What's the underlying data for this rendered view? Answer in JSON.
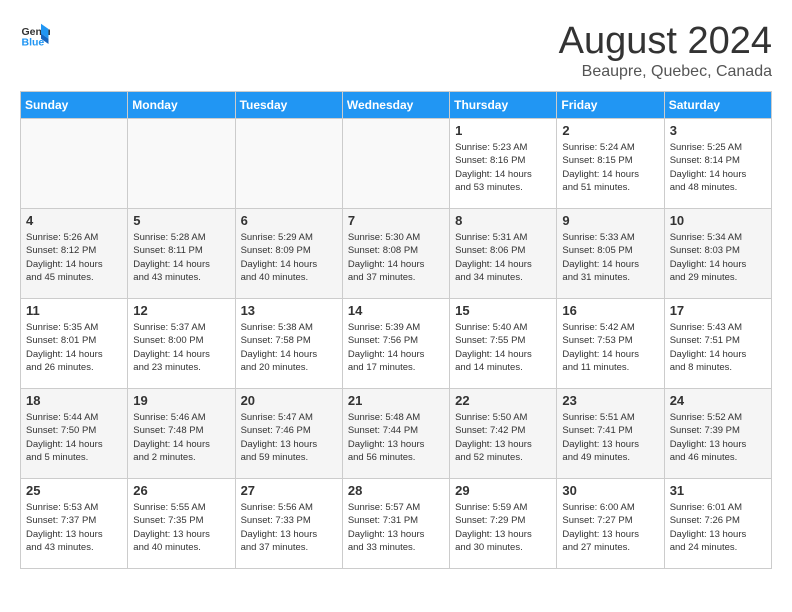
{
  "header": {
    "logo_general": "General",
    "logo_blue": "Blue",
    "month_title": "August 2024",
    "location": "Beaupre, Quebec, Canada"
  },
  "days_of_week": [
    "Sunday",
    "Monday",
    "Tuesday",
    "Wednesday",
    "Thursday",
    "Friday",
    "Saturday"
  ],
  "weeks": [
    [
      {
        "day": "",
        "info": ""
      },
      {
        "day": "",
        "info": ""
      },
      {
        "day": "",
        "info": ""
      },
      {
        "day": "",
        "info": ""
      },
      {
        "day": "1",
        "info": "Sunrise: 5:23 AM\nSunset: 8:16 PM\nDaylight: 14 hours\nand 53 minutes."
      },
      {
        "day": "2",
        "info": "Sunrise: 5:24 AM\nSunset: 8:15 PM\nDaylight: 14 hours\nand 51 minutes."
      },
      {
        "day": "3",
        "info": "Sunrise: 5:25 AM\nSunset: 8:14 PM\nDaylight: 14 hours\nand 48 minutes."
      }
    ],
    [
      {
        "day": "4",
        "info": "Sunrise: 5:26 AM\nSunset: 8:12 PM\nDaylight: 14 hours\nand 45 minutes."
      },
      {
        "day": "5",
        "info": "Sunrise: 5:28 AM\nSunset: 8:11 PM\nDaylight: 14 hours\nand 43 minutes."
      },
      {
        "day": "6",
        "info": "Sunrise: 5:29 AM\nSunset: 8:09 PM\nDaylight: 14 hours\nand 40 minutes."
      },
      {
        "day": "7",
        "info": "Sunrise: 5:30 AM\nSunset: 8:08 PM\nDaylight: 14 hours\nand 37 minutes."
      },
      {
        "day": "8",
        "info": "Sunrise: 5:31 AM\nSunset: 8:06 PM\nDaylight: 14 hours\nand 34 minutes."
      },
      {
        "day": "9",
        "info": "Sunrise: 5:33 AM\nSunset: 8:05 PM\nDaylight: 14 hours\nand 31 minutes."
      },
      {
        "day": "10",
        "info": "Sunrise: 5:34 AM\nSunset: 8:03 PM\nDaylight: 14 hours\nand 29 minutes."
      }
    ],
    [
      {
        "day": "11",
        "info": "Sunrise: 5:35 AM\nSunset: 8:01 PM\nDaylight: 14 hours\nand 26 minutes."
      },
      {
        "day": "12",
        "info": "Sunrise: 5:37 AM\nSunset: 8:00 PM\nDaylight: 14 hours\nand 23 minutes."
      },
      {
        "day": "13",
        "info": "Sunrise: 5:38 AM\nSunset: 7:58 PM\nDaylight: 14 hours\nand 20 minutes."
      },
      {
        "day": "14",
        "info": "Sunrise: 5:39 AM\nSunset: 7:56 PM\nDaylight: 14 hours\nand 17 minutes."
      },
      {
        "day": "15",
        "info": "Sunrise: 5:40 AM\nSunset: 7:55 PM\nDaylight: 14 hours\nand 14 minutes."
      },
      {
        "day": "16",
        "info": "Sunrise: 5:42 AM\nSunset: 7:53 PM\nDaylight: 14 hours\nand 11 minutes."
      },
      {
        "day": "17",
        "info": "Sunrise: 5:43 AM\nSunset: 7:51 PM\nDaylight: 14 hours\nand 8 minutes."
      }
    ],
    [
      {
        "day": "18",
        "info": "Sunrise: 5:44 AM\nSunset: 7:50 PM\nDaylight: 14 hours\nand 5 minutes."
      },
      {
        "day": "19",
        "info": "Sunrise: 5:46 AM\nSunset: 7:48 PM\nDaylight: 14 hours\nand 2 minutes."
      },
      {
        "day": "20",
        "info": "Sunrise: 5:47 AM\nSunset: 7:46 PM\nDaylight: 13 hours\nand 59 minutes."
      },
      {
        "day": "21",
        "info": "Sunrise: 5:48 AM\nSunset: 7:44 PM\nDaylight: 13 hours\nand 56 minutes."
      },
      {
        "day": "22",
        "info": "Sunrise: 5:50 AM\nSunset: 7:42 PM\nDaylight: 13 hours\nand 52 minutes."
      },
      {
        "day": "23",
        "info": "Sunrise: 5:51 AM\nSunset: 7:41 PM\nDaylight: 13 hours\nand 49 minutes."
      },
      {
        "day": "24",
        "info": "Sunrise: 5:52 AM\nSunset: 7:39 PM\nDaylight: 13 hours\nand 46 minutes."
      }
    ],
    [
      {
        "day": "25",
        "info": "Sunrise: 5:53 AM\nSunset: 7:37 PM\nDaylight: 13 hours\nand 43 minutes."
      },
      {
        "day": "26",
        "info": "Sunrise: 5:55 AM\nSunset: 7:35 PM\nDaylight: 13 hours\nand 40 minutes."
      },
      {
        "day": "27",
        "info": "Sunrise: 5:56 AM\nSunset: 7:33 PM\nDaylight: 13 hours\nand 37 minutes."
      },
      {
        "day": "28",
        "info": "Sunrise: 5:57 AM\nSunset: 7:31 PM\nDaylight: 13 hours\nand 33 minutes."
      },
      {
        "day": "29",
        "info": "Sunrise: 5:59 AM\nSunset: 7:29 PM\nDaylight: 13 hours\nand 30 minutes."
      },
      {
        "day": "30",
        "info": "Sunrise: 6:00 AM\nSunset: 7:27 PM\nDaylight: 13 hours\nand 27 minutes."
      },
      {
        "day": "31",
        "info": "Sunrise: 6:01 AM\nSunset: 7:26 PM\nDaylight: 13 hours\nand 24 minutes."
      }
    ]
  ]
}
